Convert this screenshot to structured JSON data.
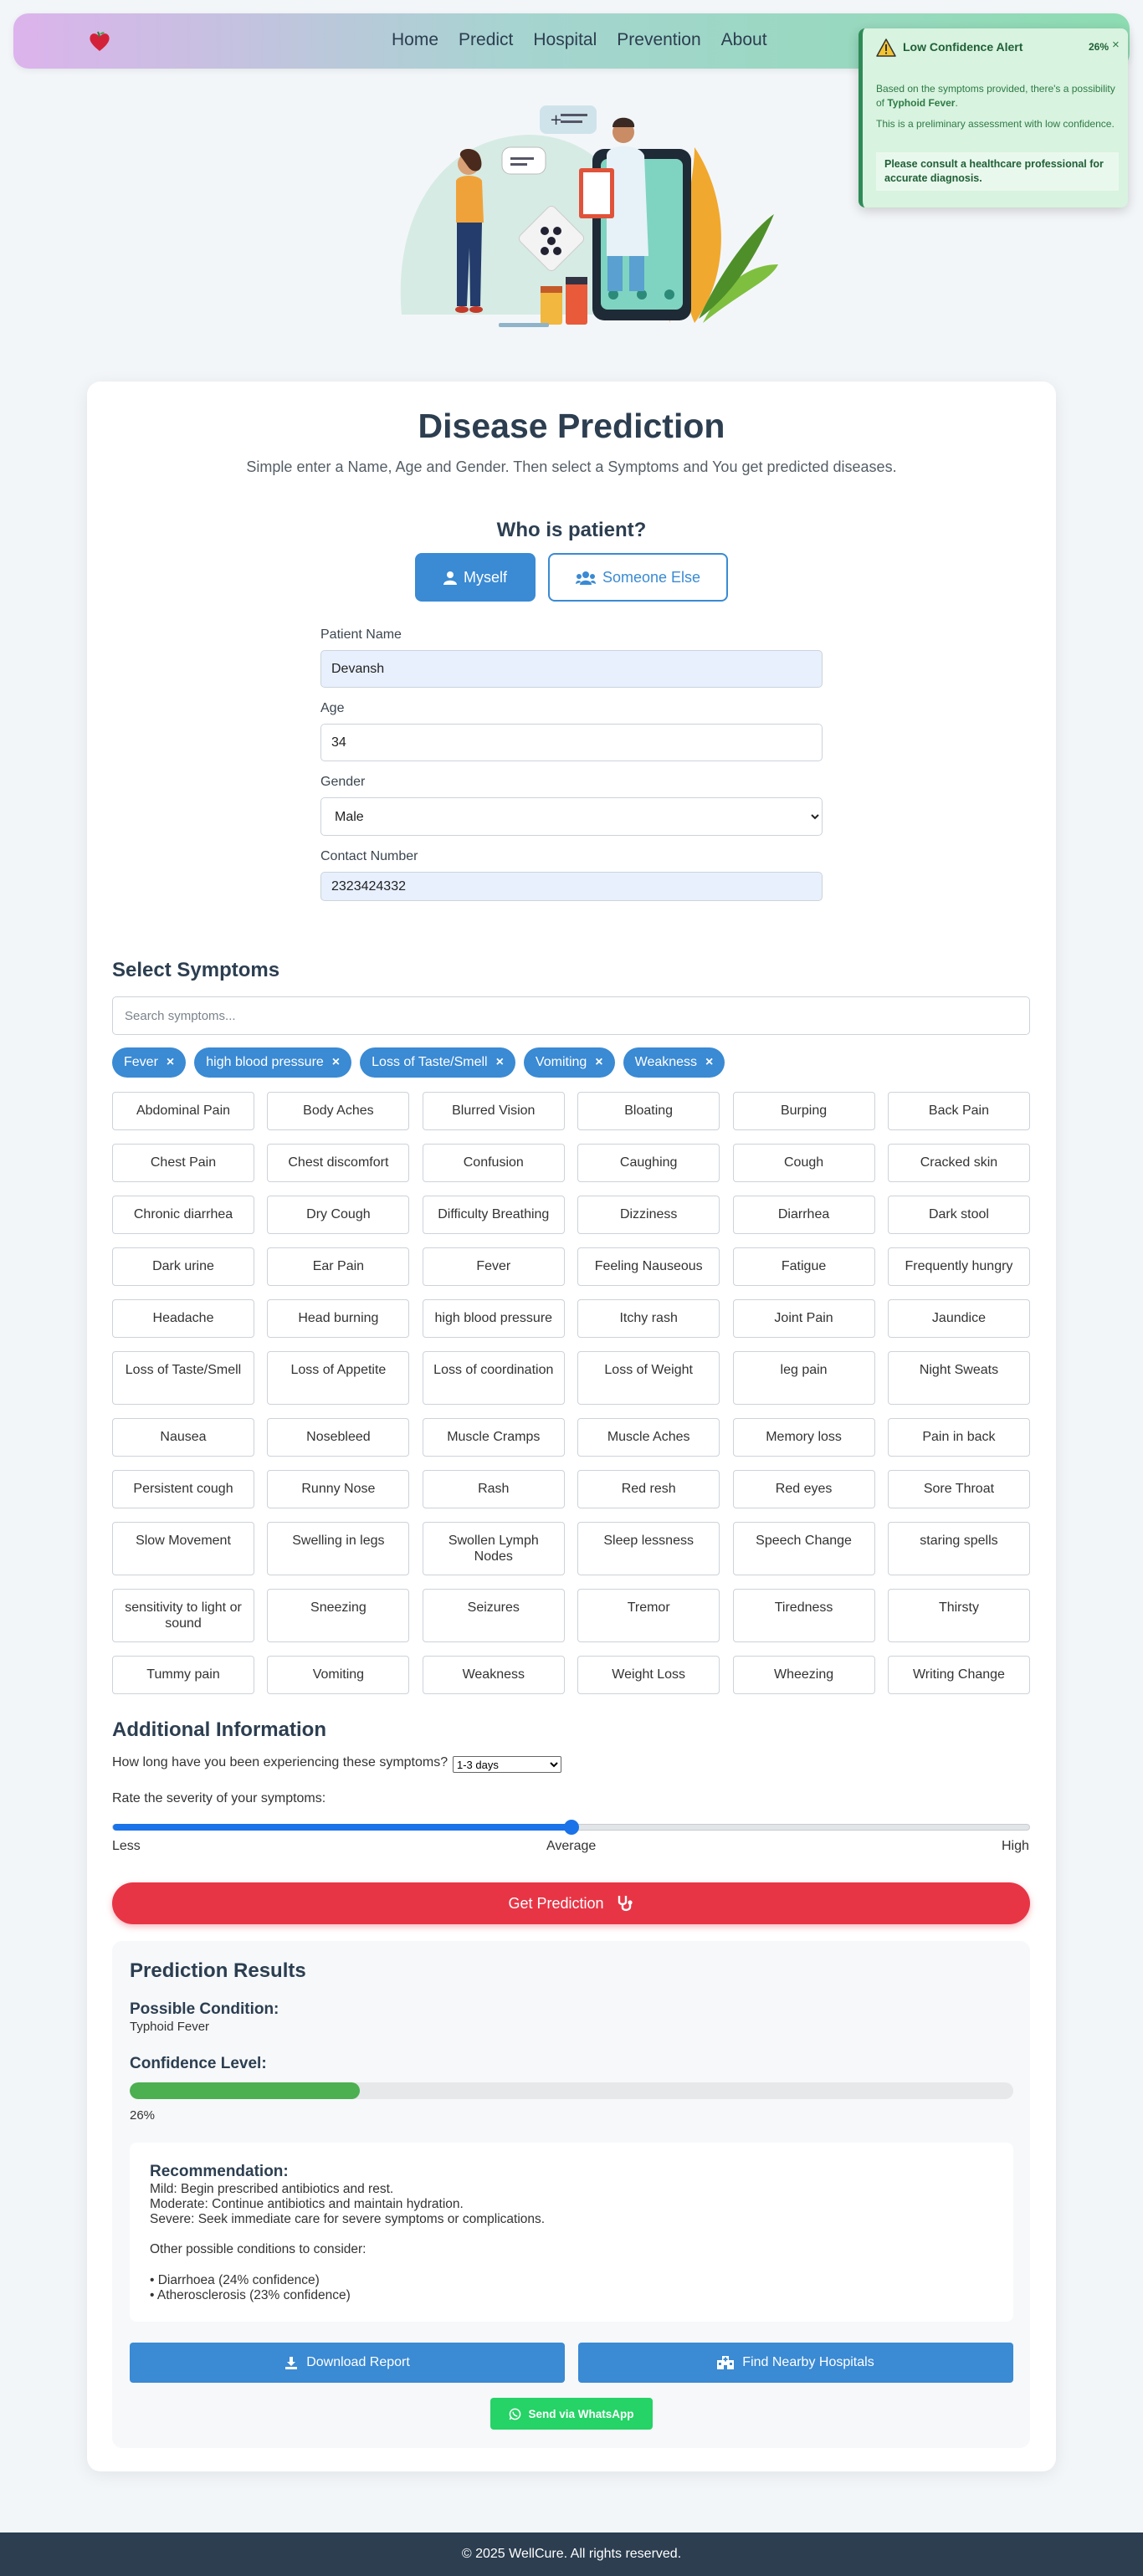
{
  "nav": {
    "links": [
      "Home",
      "Predict",
      "Hospital",
      "Prevention",
      "About"
    ]
  },
  "alert": {
    "title": "Low Confidence Alert",
    "percent": "26%",
    "close": "×",
    "line1_pre": "Based on the symptoms provided, there's a possibility of ",
    "line1_bold": "Typhoid Fever",
    "line1_post": ".",
    "line2": "This is a preliminary assessment with low confidence.",
    "advice": "Please consult a healthcare professional for accurate diagnosis."
  },
  "page": {
    "title": "Disease Prediction",
    "subtitle": "Simple enter a Name, Age and Gender. Then select a Symptoms and You get predicted diseases.",
    "who_heading": "Who is patient?",
    "btn_myself": "Myself",
    "btn_someone": "Someone Else"
  },
  "form": {
    "name_label": "Patient Name",
    "name_value": "Devansh",
    "age_label": "Age",
    "age_value": "34",
    "gender_label": "Gender",
    "gender_value": "Male",
    "contact_label": "Contact Number",
    "contact_value": "2323424332"
  },
  "symptoms": {
    "heading": "Select Symptoms",
    "search_placeholder": "Search symptoms...",
    "selected": [
      "Fever",
      "high blood pressure",
      "Loss of Taste/Smell",
      "Vomiting",
      "Weakness"
    ],
    "list": [
      "Abdominal Pain",
      "Body Aches",
      "Blurred Vision",
      "Bloating",
      "Burping",
      "Back Pain",
      "Chest Pain",
      "Chest discomfort",
      "Confusion",
      "Caughing",
      "Cough",
      "Cracked skin",
      "Chronic diarrhea",
      "Dry Cough",
      "Difficulty Breathing",
      "Dizziness",
      "Diarrhea",
      "Dark stool",
      "Dark urine",
      "Ear Pain",
      "Fever",
      "Feeling Nauseous",
      "Fatigue",
      "Frequently hungry",
      "Headache",
      "Head burning",
      "high blood pressure",
      "Itchy rash",
      "Joint Pain",
      "Jaundice",
      "Loss of Taste/Smell",
      "Loss of Appetite",
      "Loss of coordination",
      "Loss of Weight",
      "leg pain",
      "Night Sweats",
      "Nausea",
      "Nosebleed",
      "Muscle Cramps",
      "Muscle Aches",
      "Memory loss",
      "Pain in back",
      "Persistent cough",
      "Runny Nose",
      "Rash",
      "Red resh",
      "Red eyes",
      "Sore Throat",
      "Slow Movement",
      "Swelling in legs",
      "Swollen Lymph Nodes",
      "Sleep lessness",
      "Speech Change",
      "staring spells",
      "sensitivity to light or sound",
      "Sneezing",
      "Seizures",
      "Tremor",
      "Tiredness",
      "Thirsty",
      "Tummy pain",
      "Vomiting",
      "Weakness",
      "Weight Loss",
      "Wheezing",
      "Writing Change"
    ]
  },
  "additional": {
    "heading": "Additional Information",
    "duration_question": "How long have you been experiencing these symptoms?",
    "duration_value": "1-3 days",
    "severity_question": "Rate the severity of your symptoms:",
    "severity_level": 0.5,
    "label_less": "Less",
    "label_average": "Average",
    "label_high": "High"
  },
  "predict_button": "Get Prediction",
  "results": {
    "heading": "Prediction Results",
    "condition_label": "Possible Condition:",
    "condition_value": "Typhoid Fever",
    "confidence_label": "Confidence Level:",
    "confidence_value": 0.26,
    "confidence_text": "26%",
    "rec_heading": "Recommendation:",
    "rec_mild": "Mild: Begin prescribed antibiotics and rest.",
    "rec_moderate": "Moderate: Continue antibiotics and maintain hydration.",
    "rec_severe": "Severe: Seek immediate care for severe symptoms or complications.",
    "other_heading": "Other possible conditions to consider:",
    "other_1": "• Diarrhoea (24% confidence)",
    "other_2": "• Atherosclerosis (23% confidence)",
    "btn_download": "Download Report",
    "btn_hospitals": "Find Nearby Hospitals",
    "btn_whatsapp": "Send via WhatsApp"
  },
  "footer": "© 2025 WellCure. All rights reserved.",
  "colors": {
    "primary": "#3a8ad4",
    "danger": "#e73546",
    "success": "#4caf50",
    "whatsapp": "#25d366",
    "dark": "#2c3e50"
  }
}
